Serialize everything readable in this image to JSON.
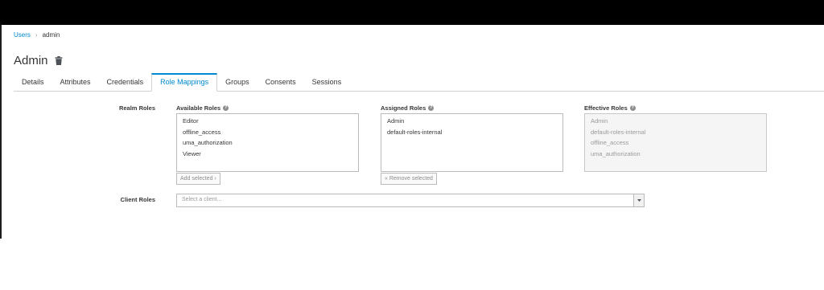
{
  "breadcrumb": {
    "parent": "Users",
    "separator": "›",
    "current": "admin"
  },
  "page": {
    "title": "Admin",
    "delete_icon": "trash-icon"
  },
  "tabs": [
    {
      "label": "Details"
    },
    {
      "label": "Attributes"
    },
    {
      "label": "Credentials"
    },
    {
      "label": "Role Mappings",
      "active": true
    },
    {
      "label": "Groups"
    },
    {
      "label": "Consents"
    },
    {
      "label": "Sessions"
    }
  ],
  "realm_roles": {
    "label": "Realm Roles",
    "available": {
      "label": "Available Roles",
      "items": [
        "Editor",
        "offline_access",
        "uma_authorization",
        "Viewer"
      ],
      "button": "Add selected ›"
    },
    "assigned": {
      "label": "Assigned Roles",
      "items": [
        "Admin",
        "default-roles-internal"
      ],
      "button": "« Remove selected"
    },
    "effective": {
      "label": "Effective Roles",
      "items": [
        "Admin",
        "default-roles-internal",
        "offline_access",
        "uma_authorization"
      ]
    }
  },
  "client_roles": {
    "label": "Client Roles",
    "placeholder": "Select a client..."
  },
  "colors": {
    "link": "#0088ce",
    "text": "#363636",
    "border": "#d1d1d1"
  }
}
